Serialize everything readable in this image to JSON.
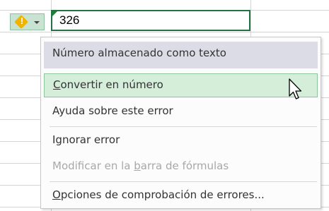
{
  "cell": {
    "value": "326"
  },
  "smart_tag": {
    "icon": "warning-icon",
    "icon_color": "#f0b400",
    "mark": "!"
  },
  "menu": {
    "header": "Número almacenado como texto",
    "items": [
      {
        "pre": "",
        "key": "C",
        "post": "onvertir en número",
        "highlighted": true,
        "enabled": true
      },
      {
        "pre": "Ayuda sobre este error",
        "key": "",
        "post": "",
        "highlighted": false,
        "enabled": true
      },
      {
        "pre": "Ignorar error",
        "key": "",
        "post": "",
        "highlighted": false,
        "enabled": true
      },
      {
        "pre": "Modificar en la ",
        "key": "b",
        "post": "arra de fórmulas",
        "highlighted": false,
        "enabled": false
      },
      {
        "pre": "",
        "key": "O",
        "post": "pciones de comprobación de errores...",
        "highlighted": false,
        "enabled": true
      }
    ]
  },
  "colors": {
    "accent": "#217346",
    "highlight": "#d4eed9",
    "header_bg": "#dcdce6"
  }
}
